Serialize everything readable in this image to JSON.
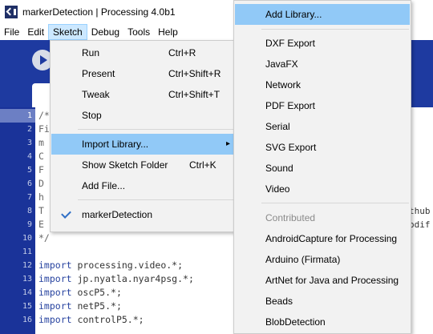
{
  "window": {
    "title": "markerDetection | Processing 4.0b1"
  },
  "menubar": [
    {
      "label": "File"
    },
    {
      "label": "Edit"
    },
    {
      "label": "Sketch"
    },
    {
      "label": "Debug"
    },
    {
      "label": "Tools"
    },
    {
      "label": "Help"
    }
  ],
  "sketch_menu": {
    "items": [
      {
        "label": "Run",
        "shortcut": "Ctrl+R"
      },
      {
        "label": "Present",
        "shortcut": "Ctrl+Shift+R"
      },
      {
        "label": "Tweak",
        "shortcut": "Ctrl+Shift+T"
      },
      {
        "label": "Stop",
        "shortcut": ""
      },
      {
        "label": "Import Library...",
        "shortcut": ""
      },
      {
        "label": "Show Sketch Folder",
        "shortcut": "Ctrl+K"
      },
      {
        "label": "Add File...",
        "shortcut": ""
      },
      {
        "label": "markerDetection",
        "shortcut": ""
      }
    ]
  },
  "library_menu": {
    "top": "Add Library...",
    "core": [
      "DXF Export",
      "JavaFX",
      "Network",
      "PDF Export",
      "Serial",
      "SVG Export",
      "Sound",
      "Video"
    ],
    "contributed_header": "Contributed",
    "contributed": [
      "AndroidCapture for Processing",
      "Arduino (Firmata)",
      "ArtNet for Java and Processing",
      "Beads",
      "BlobDetection"
    ]
  },
  "editor": {
    "line_numbers": [
      "1",
      "2",
      "3",
      "4",
      "5",
      "6",
      "7",
      "8",
      "9",
      "10",
      "11",
      "12",
      "13",
      "14",
      "15",
      "16"
    ],
    "lines": [
      "/*",
      "Fi",
      "m",
      "C",
      "F",
      "D",
      "h",
      "T",
      "E",
      "",
      "*/",
      "",
      "import processing.video.*;",
      "import jp.nyatla.nyar4psg.*;",
      "import oscP5.*;",
      "import netP5.*;",
      "import controlP5.*;"
    ],
    "right_fragments": [
      "thub",
      "odif"
    ]
  }
}
